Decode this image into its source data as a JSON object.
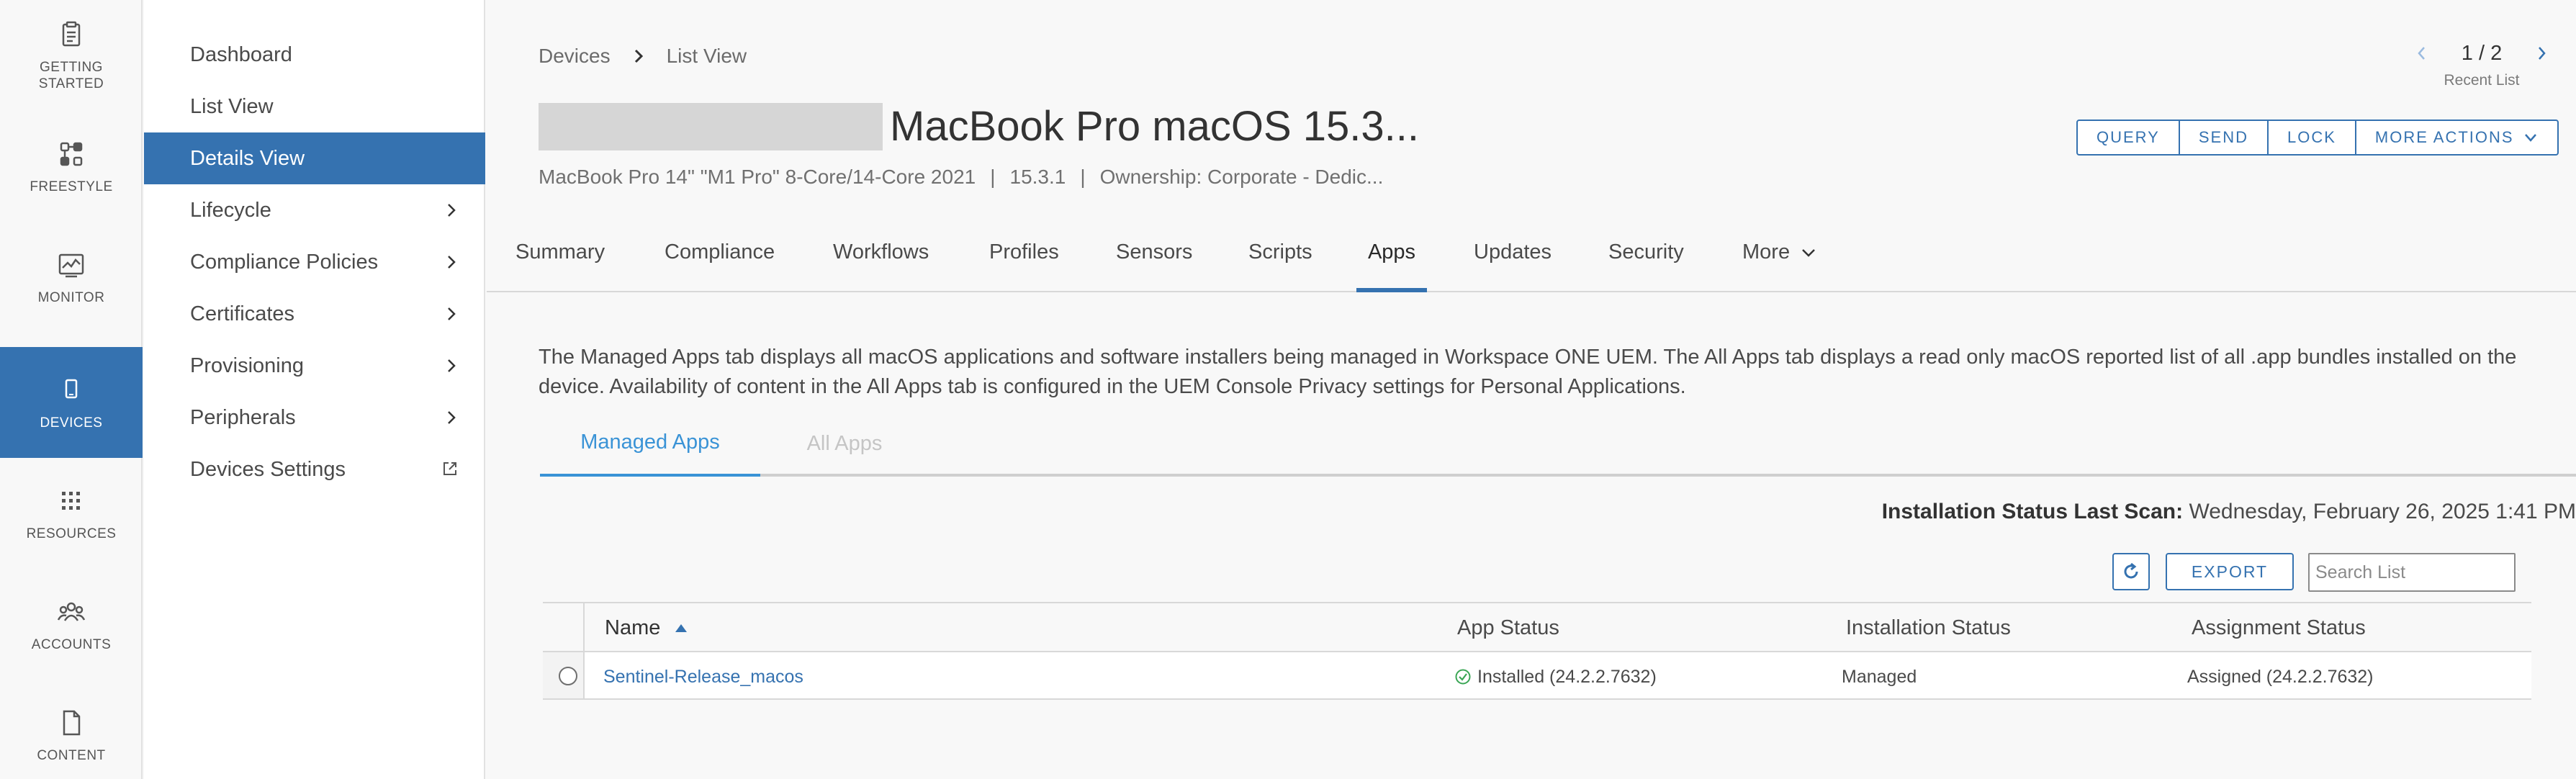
{
  "rail": {
    "items": [
      {
        "label": "GETTING STARTED",
        "icon": "clipboard-icon"
      },
      {
        "label": "FREESTYLE",
        "icon": "freestyle-icon"
      },
      {
        "label": "MONITOR",
        "icon": "monitor-icon"
      },
      {
        "label": "DEVICES",
        "icon": "device-icon"
      },
      {
        "label": "RESOURCES",
        "icon": "grid-icon"
      },
      {
        "label": "ACCOUNTS",
        "icon": "accounts-icon"
      },
      {
        "label": "CONTENT",
        "icon": "document-icon"
      }
    ],
    "active": "DEVICES",
    "accent": "#3572b0"
  },
  "subnav": {
    "items": [
      {
        "label": "Dashboard"
      },
      {
        "label": "List View"
      },
      {
        "label": "Details View"
      },
      {
        "label": "Lifecycle"
      },
      {
        "label": "Compliance Policies"
      },
      {
        "label": "Certificates"
      },
      {
        "label": "Provisioning"
      },
      {
        "label": "Peripherals"
      },
      {
        "label": "Devices Settings"
      }
    ],
    "active": "Details View"
  },
  "breadcrumb": {
    "root": "Devices",
    "current": "List View"
  },
  "pager": {
    "count": "1 / 2",
    "label": "Recent List"
  },
  "device": {
    "title": "MacBook Pro macOS 15.3...",
    "model": "MacBook Pro 14\" \"M1 Pro\" 8-Core/14-Core 2021",
    "os_version": "15.3.1",
    "ownership": "Ownership: Corporate - Dedic..."
  },
  "actions": {
    "query": "QUERY",
    "send": "SEND",
    "lock": "LOCK",
    "more": "MORE ACTIONS"
  },
  "tabs": {
    "summary": "Summary",
    "compliance": "Compliance",
    "workflows": "Workflows",
    "profiles": "Profiles",
    "sensors": "Sensors",
    "scripts": "Scripts",
    "apps": "Apps",
    "updates": "Updates",
    "security": "Security",
    "more": "More",
    "active": "Apps"
  },
  "description": "The Managed Apps tab displays all macOS applications and software installers being managed in Workspace ONE UEM. The All Apps tab displays a read only macOS reported list of all .app bundles installed on the device. Availability of content in the All Apps tab is configured in the UEM Console Privacy settings for Personal Applications.",
  "subtabs": {
    "managed": "Managed Apps",
    "all": "All Apps",
    "active": "Managed Apps"
  },
  "scan": {
    "label": "Installation Status Last Scan:",
    "value": "Wednesday, February 26, 2025 1:41 PM"
  },
  "toolbar": {
    "export": "EXPORT",
    "search_placeholder": "Search List"
  },
  "grid": {
    "columns": {
      "name": "Name",
      "app_status": "App Status",
      "installation_status": "Installation Status",
      "assignment_status": "Assignment Status"
    },
    "sort": "Name ascending",
    "rows": [
      {
        "name": "Sentinel-Release_macos",
        "app_status": "Installed (24.2.2.7632)",
        "installation_status": "Managed",
        "assignment_status": "Assigned (24.2.2.7632)"
      }
    ]
  }
}
